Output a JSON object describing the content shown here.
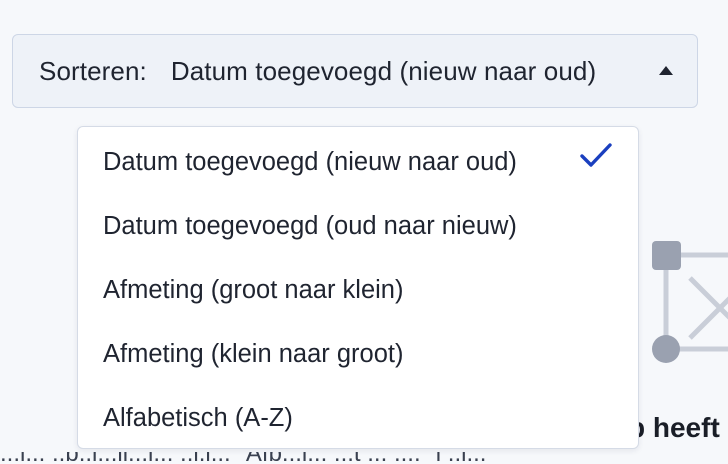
{
  "sort": {
    "label": "Sorteren:",
    "selected": "Datum toegevoegd (nieuw naar oud)",
    "caret_icon": "caret-up-icon"
  },
  "menu": {
    "items": [
      {
        "label": "Datum toegevoegd (nieuw naar oud)",
        "selected": true
      },
      {
        "label": "Datum toegevoegd (oud naar nieuw)",
        "selected": false
      },
      {
        "label": "Afmeting (groot naar klein)",
        "selected": false
      },
      {
        "label": "Afmeting (klein naar groot)",
        "selected": false
      },
      {
        "label": "Alfabetisch (A-Z)",
        "selected": false
      }
    ],
    "check_icon": "checkmark-icon",
    "check_color": "#1a3fbf"
  },
  "background": {
    "heading_fragment": "p heeft",
    "subtext_fragment": "...l... ..b..l...ll...l... ..l.l... \"Afb...l... ...t ... ....\" l ..l..."
  },
  "colors": {
    "page_bg": "#f6f8fb",
    "control_bg": "#eef2f8",
    "control_border": "#cdd6e6",
    "illustration": "#b8bfcc"
  }
}
